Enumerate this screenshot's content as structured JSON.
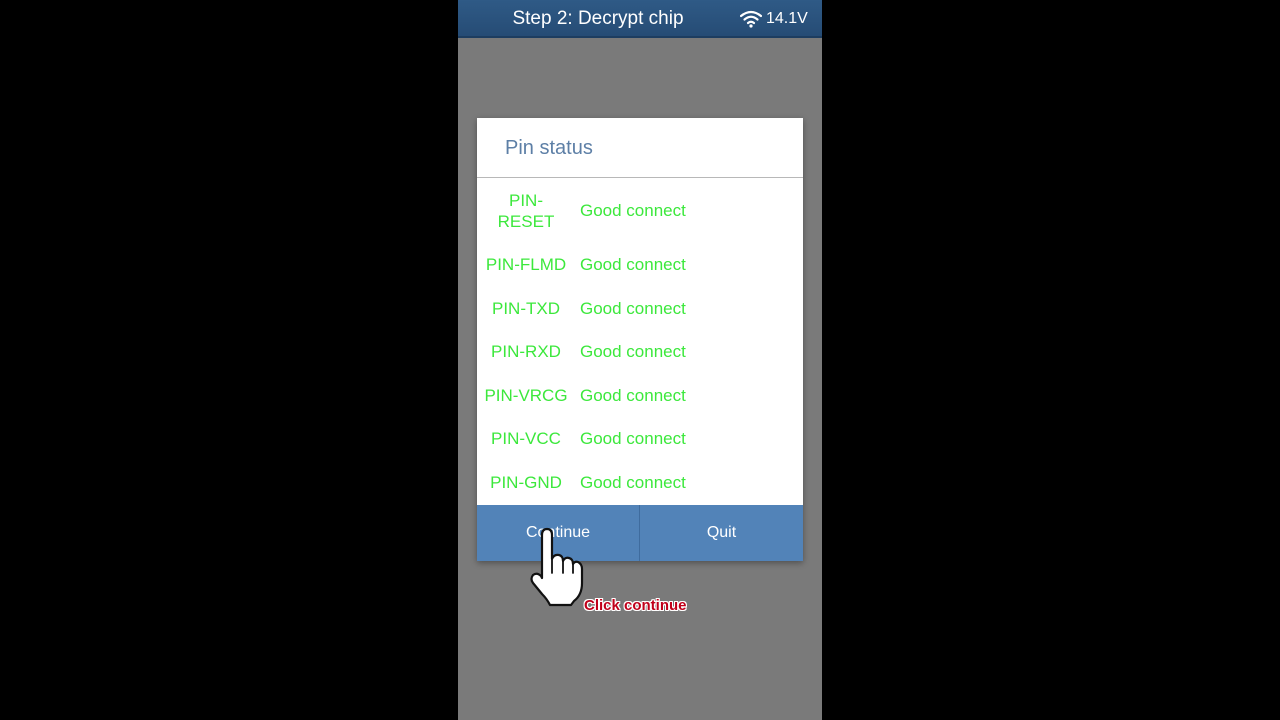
{
  "header": {
    "title": "Step 2: Decrypt chip",
    "wifi_icon": "wifi-icon",
    "voltage": "14.1V"
  },
  "dialog": {
    "title": "Pin status",
    "rows": [
      {
        "pin_line1": "PIN-",
        "pin_line2": "RESET",
        "status": "Good connect"
      },
      {
        "pin": "PIN-FLMD",
        "status": "Good connect"
      },
      {
        "pin": "PIN-TXD",
        "status": "Good connect"
      },
      {
        "pin": "PIN-RXD",
        "status": "Good connect"
      },
      {
        "pin": "PIN-VRCG",
        "status": "Good connect"
      },
      {
        "pin": "PIN-VCC",
        "status": "Good connect"
      },
      {
        "pin": "PIN-GND",
        "status": "Good connect"
      }
    ],
    "continue_label": "Continue",
    "quit_label": "Quit"
  },
  "overlay": {
    "pointer_icon": "hand-pointer-icon",
    "caption": "Click continue"
  },
  "colors": {
    "header_bg": "#2b5580",
    "status_green": "#3ce83c",
    "title_blue": "#5d7fa6",
    "button_blue": "#5283b8",
    "caption_red": "#c0001a",
    "backdrop_gray": "#7a7a7a"
  }
}
